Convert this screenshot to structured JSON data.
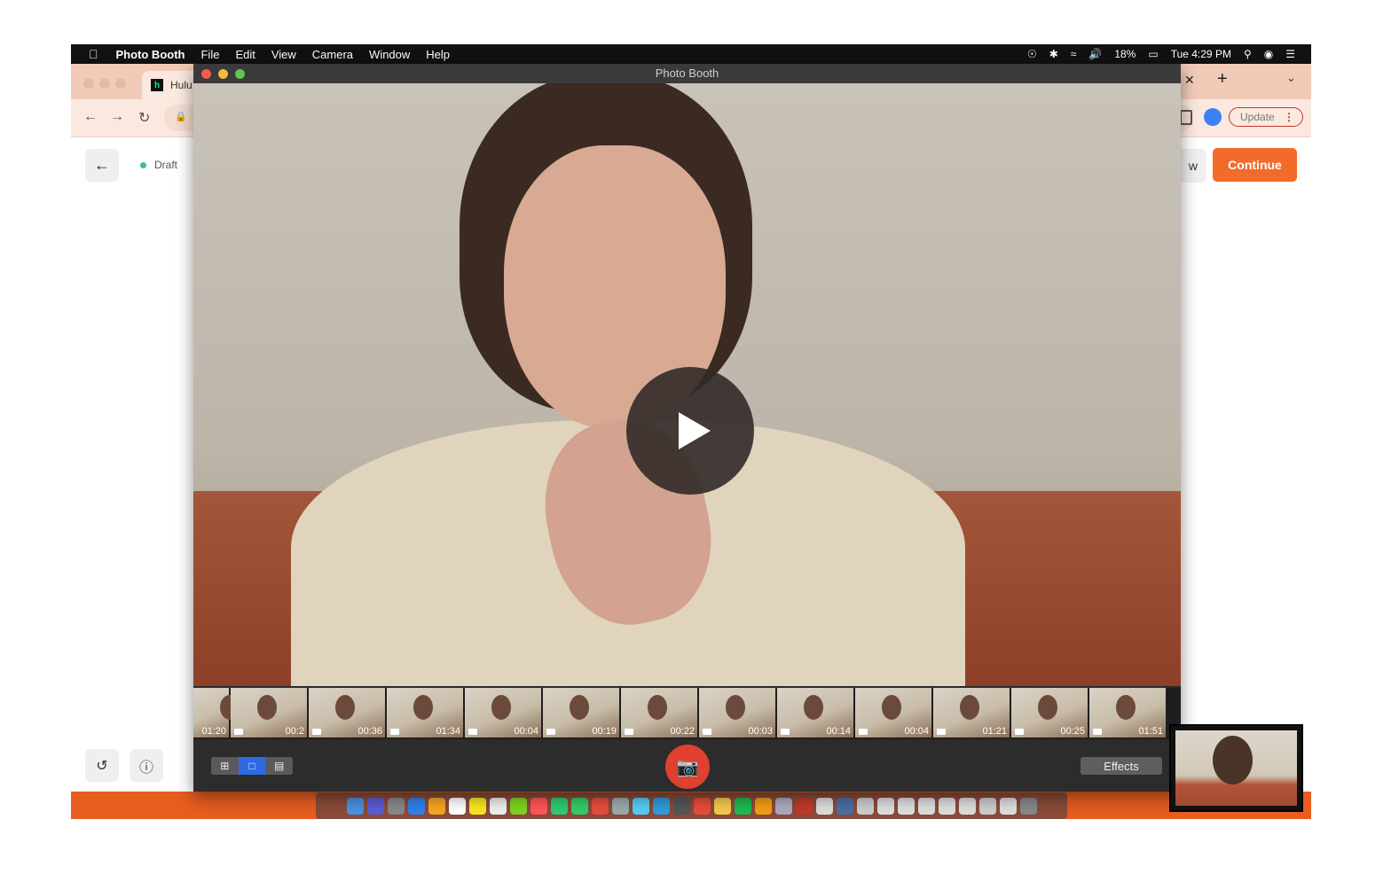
{
  "menubar": {
    "app_name": "Photo Booth",
    "items": [
      "File",
      "Edit",
      "View",
      "Camera",
      "Window",
      "Help"
    ],
    "battery": "18%",
    "clock": "Tue 4:29 PM"
  },
  "browser": {
    "tab_title": "Hulu",
    "update_label": "Update"
  },
  "page": {
    "status": "Draft",
    "preview_label_partial": "w",
    "continue_label": "Continue",
    "accent_color": "#f26b2b"
  },
  "photobooth": {
    "window_title": "Photo Booth",
    "effects_label": "Effects",
    "thumbnails": [
      "01:20",
      "00:2",
      "00:36",
      "01:34",
      "00:04",
      "00:19",
      "00:22",
      "00:03",
      "00:14",
      "00:04",
      "01:21",
      "00:25",
      "01:51"
    ]
  }
}
